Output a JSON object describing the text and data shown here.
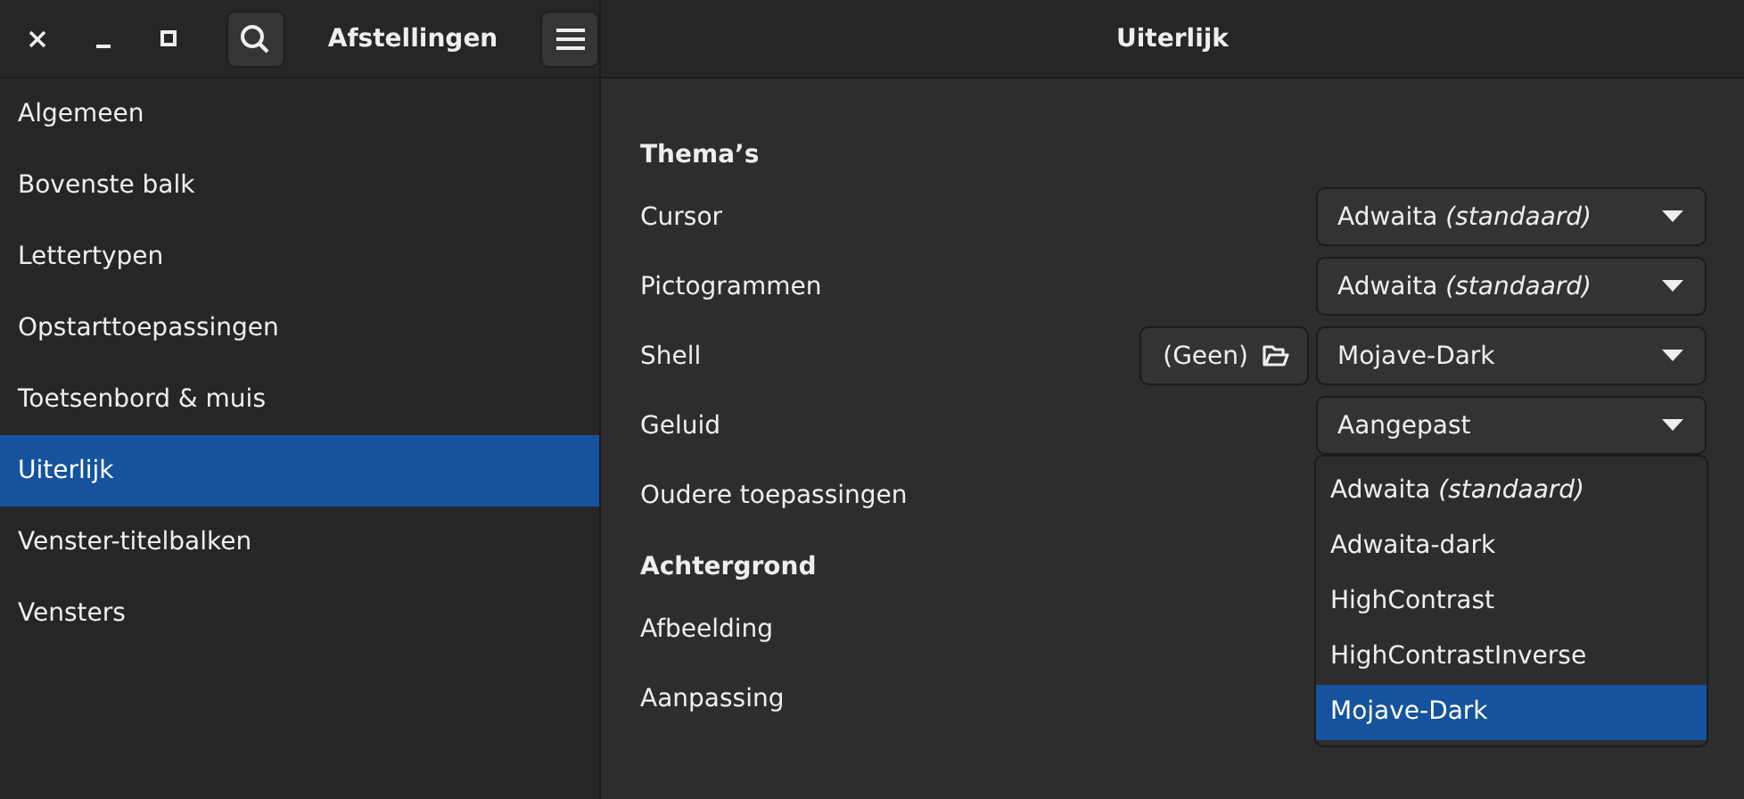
{
  "header": {
    "title": "Afstellingen",
    "page_title": "Uiterlijk"
  },
  "sidebar": {
    "items": [
      {
        "label": "Algemeen",
        "selected": false
      },
      {
        "label": "Bovenste balk",
        "selected": false
      },
      {
        "label": "Lettertypen",
        "selected": false
      },
      {
        "label": "Opstarttoepassingen",
        "selected": false
      },
      {
        "label": "Toetsenbord & muis",
        "selected": false
      },
      {
        "label": "Uiterlijk",
        "selected": true
      },
      {
        "label": "Venster-titelbalken",
        "selected": false
      },
      {
        "label": "Vensters",
        "selected": false
      }
    ]
  },
  "sections": [
    {
      "title": "Thema’s",
      "rows": [
        {
          "label": "Cursor",
          "combo": "Adwaita *(standaard)*"
        },
        {
          "label": "Pictogrammen",
          "combo": "Adwaita *(standaard)*"
        },
        {
          "label": "Shell",
          "file_button": "(Geen)",
          "combo": "Mojave-Dark"
        },
        {
          "label": "Geluid",
          "combo": "Aangepast"
        },
        {
          "label": "Oudere toepassingen"
        }
      ]
    },
    {
      "title": "Achtergrond",
      "rows": [
        {
          "label": "Afbeelding"
        },
        {
          "label": "Aanpassing"
        }
      ]
    }
  ],
  "popup": {
    "items": [
      {
        "label": "Adwaita *(standaard)*",
        "selected": false
      },
      {
        "label": "Adwaita-dark",
        "selected": false
      },
      {
        "label": "HighContrast",
        "selected": false
      },
      {
        "label": "HighContrastInverse",
        "selected": false
      },
      {
        "label": "Mojave-Dark",
        "selected": true
      }
    ]
  }
}
